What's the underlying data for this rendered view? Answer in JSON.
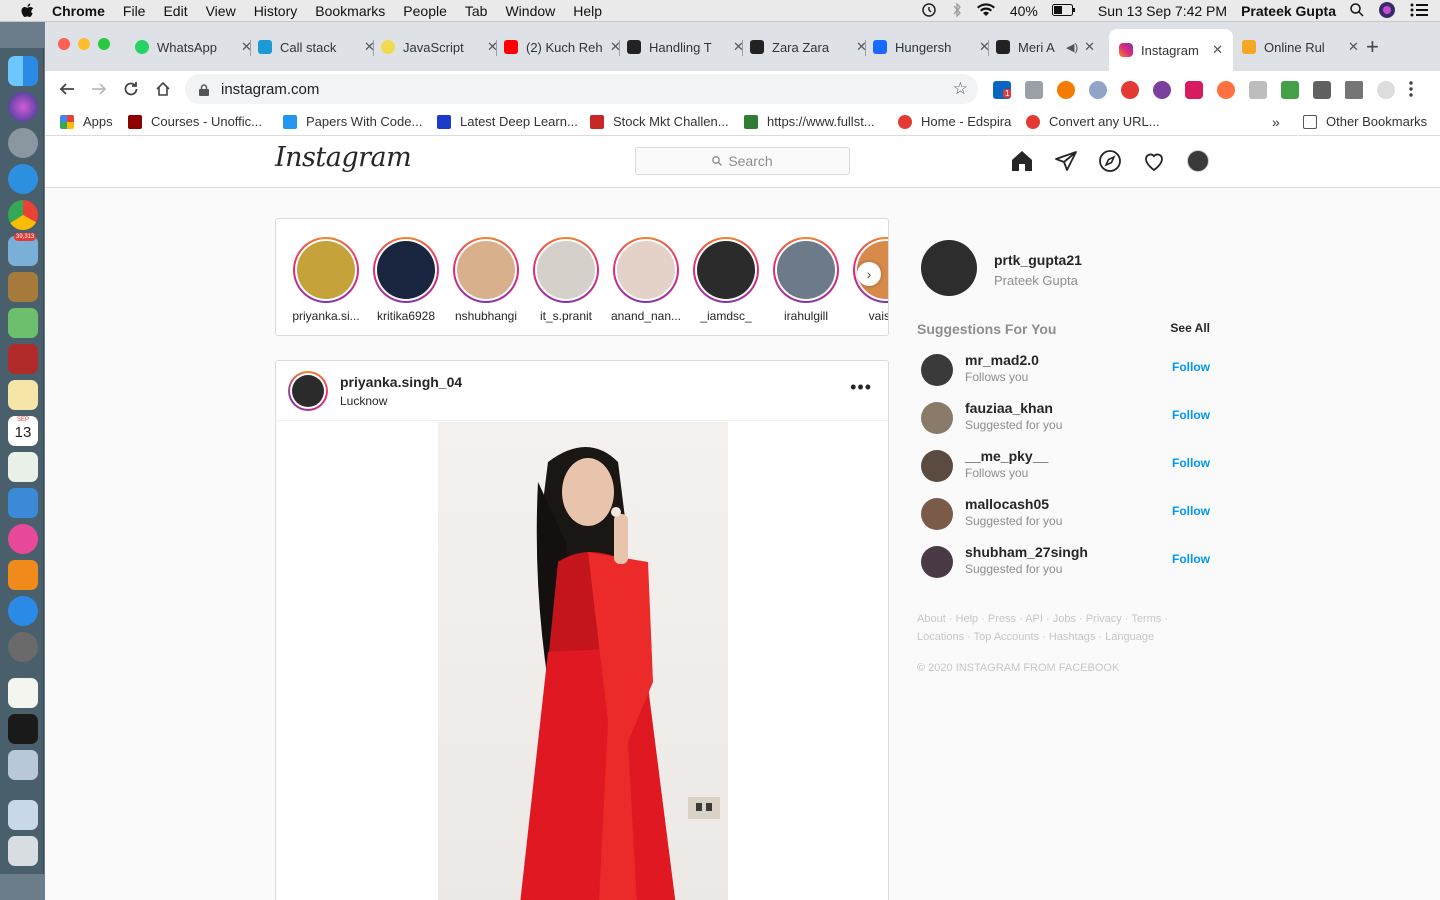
{
  "menubar": {
    "app_name": "Chrome",
    "items": [
      "File",
      "Edit",
      "View",
      "History",
      "Bookmarks",
      "People",
      "Tab",
      "Window",
      "Help"
    ],
    "battery": "40%",
    "datetime": "Sun 13 Sep  7:42 PM",
    "user": "Prateek Gupta"
  },
  "dock": {
    "mail_badge": "39,313",
    "calendar_month": "SEP",
    "calendar_day": "13"
  },
  "tabs": [
    {
      "label": "WhatsApp",
      "icon": "whatsapp-icon",
      "color": "#25d366"
    },
    {
      "label": "Call stack",
      "icon": "callstack-icon",
      "color": "#1b9ad6"
    },
    {
      "label": "JavaScript",
      "icon": "javascript-icon",
      "color": "#f0db4f"
    },
    {
      "label": "(2) Kuch Reh",
      "icon": "youtube-icon",
      "color": "#ff0000"
    },
    {
      "label": "Handling T",
      "icon": "react-icon",
      "color": "#222222"
    },
    {
      "label": "Zara Zara",
      "icon": "vimeo-icon",
      "color": "#222222"
    },
    {
      "label": "Hungersh",
      "icon": "behance-icon",
      "color": "#1769ff"
    },
    {
      "label": "Meri A",
      "icon": "vimeo-icon",
      "color": "#222222"
    },
    {
      "label": "Instagram",
      "icon": "instagram-icon",
      "color": "#e1306c",
      "active": true
    },
    {
      "label": "Online Rul",
      "icon": "r-icon",
      "color": "#f5a623"
    }
  ],
  "toolbar": {
    "url": "instagram.com",
    "linkedin_badge": "1"
  },
  "bookmarks": [
    {
      "label": "Apps",
      "color": "#e94235"
    },
    {
      "label": "Courses - Unoffic...",
      "color": "#8b0000"
    },
    {
      "label": "Papers With Code...",
      "color": "#2196f3"
    },
    {
      "label": "Latest Deep Learn...",
      "color": "#1a3cc8"
    },
    {
      "label": "Stock Mkt Challen...",
      "color": "#c62828"
    },
    {
      "label": "https://www.fullst...",
      "color": "#2e7d32"
    },
    {
      "label": "Home - Edspira",
      "color": "#e53935"
    },
    {
      "label": "Convert any URL...",
      "color": "#e53935"
    }
  ],
  "other_bookmarks": "Other Bookmarks",
  "instagram": {
    "logo": "Instagram",
    "search_placeholder": "Search",
    "stories": [
      {
        "name": "priyanka.si...",
        "color": "#c6a23a"
      },
      {
        "name": "kritika6928",
        "color": "#1a2540"
      },
      {
        "name": "nshubhangi",
        "color": "#d9b08c"
      },
      {
        "name": "it_s.pranit",
        "color": "#d6d0cb"
      },
      {
        "name": "anand_nan...",
        "color": "#e4d2c8"
      },
      {
        "name": "_iamdsc_",
        "color": "#2b2b2b"
      },
      {
        "name": "irahulgill",
        "color": "#6c7a8a"
      },
      {
        "name": "vaishn",
        "color": "#d88a4a"
      }
    ],
    "post": {
      "user": "priyanka.singh_04",
      "location": "Lucknow",
      "more": "•••"
    },
    "me": {
      "username": "prtk_gupta21",
      "fullname": "Prateek Gupta"
    },
    "suggestions_title": "Suggestions For You",
    "see_all": "See All",
    "suggestions": [
      {
        "user": "mr_mad2.0",
        "sub": "Follows you",
        "color": "#3a3a3a"
      },
      {
        "user": "fauziaa_khan",
        "sub": "Suggested for you",
        "color": "#8a7a6a"
      },
      {
        "user": "__me_pky__",
        "sub": "Follows you",
        "color": "#5a4a40"
      },
      {
        "user": "mallocash05",
        "sub": "Suggested for you",
        "color": "#7a5a48"
      },
      {
        "user": "shubham_27singh",
        "sub": "Suggested for you",
        "color": "#4a3a45"
      }
    ],
    "follow_label": "Follow",
    "footer": "About · Help · Press · API · Jobs · Privacy · Terms · Locations · Top Accounts · Hashtags · Language",
    "copyright": "© 2020 Instagram from Facebook"
  }
}
